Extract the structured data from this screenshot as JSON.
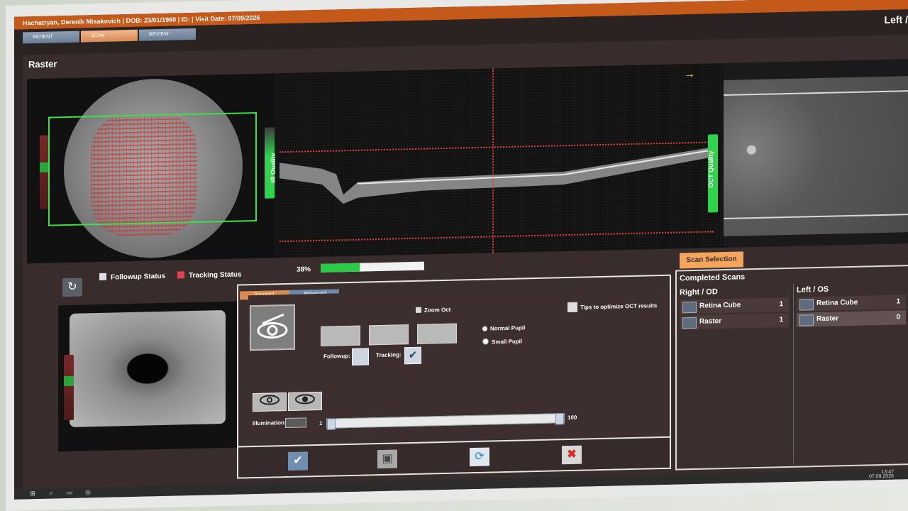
{
  "window": {
    "title": "Hachatryan, Derenik Misakovich  |  DOB: 23/01/1960  |  ID:  |  Visit Date: 07/09/2026",
    "eye_label": "Left /"
  },
  "tabs": [
    {
      "label": "PATIENT"
    },
    {
      "label": "SCAN"
    },
    {
      "label": "REVIEW"
    }
  ],
  "section_title": "Raster",
  "quality": {
    "ir_label": "IR Quality",
    "oct_label": "OCT Quality"
  },
  "legend": {
    "followup": "Followup Status",
    "tracking": "Tracking Status",
    "followup_color": "#e0e0e0",
    "tracking_color": "#e3424d"
  },
  "progress": {
    "label": "38%",
    "value": 0.38
  },
  "controls": {
    "subtabs": [
      "Standard",
      "Advanced"
    ],
    "zoom_oct": "Zoom Oct",
    "tips": "Tips to optimize OCT results",
    "followup": "Followup:",
    "tracking": "Tracking:",
    "normal_pupil": "Normal Pupil",
    "small_pupil": "Small Pupil",
    "illumination": "Illumination:",
    "slider_min": "1",
    "slider_max": "100"
  },
  "scan_selection": "Scan Selection",
  "completed": {
    "title": "Completed Scans",
    "right_head": "Right / OD",
    "left_head": "Left / OS",
    "right_rows": [
      {
        "name": "Retina Cube",
        "count": "1"
      },
      {
        "name": "Raster",
        "count": "1"
      }
    ],
    "left_rows": [
      {
        "name": "Retina Cube",
        "count": "1"
      },
      {
        "name": "Raster",
        "count": "0"
      }
    ]
  },
  "taskbar": {
    "time": "13:47",
    "date": "07.09.2026"
  }
}
